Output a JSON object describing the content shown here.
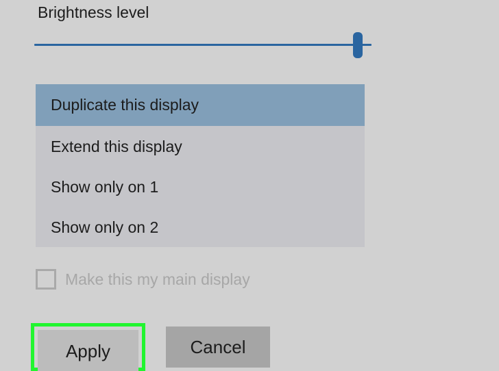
{
  "brightness": {
    "label": "Brightness level",
    "value_fraction": 0.96
  },
  "display_options": {
    "selected_index": 0,
    "items": [
      {
        "label": "Duplicate this display"
      },
      {
        "label": "Extend this display"
      },
      {
        "label": "Show only on 1"
      },
      {
        "label": "Show only on 2"
      }
    ]
  },
  "main_display": {
    "label": "Make this my main display",
    "checked": false,
    "enabled": false
  },
  "buttons": {
    "apply_label": "Apply",
    "cancel_label": "Cancel"
  },
  "colors": {
    "accent": "#2a65a0",
    "selection": "#809fb9",
    "highlight": "#21f52f"
  }
}
